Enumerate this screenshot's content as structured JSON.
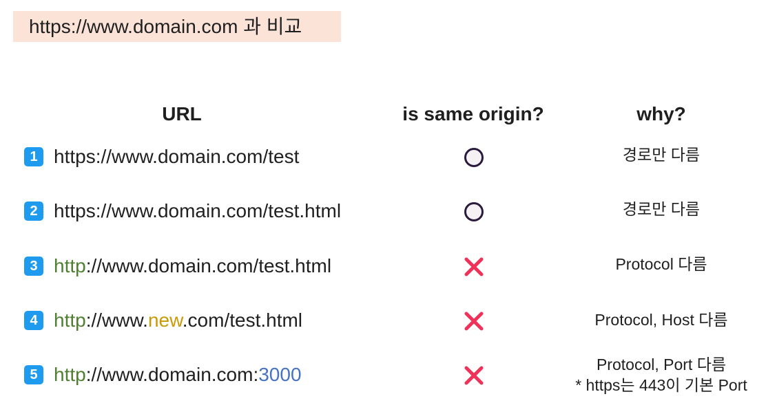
{
  "title": "https://www.domain.com 과 비교",
  "headers": {
    "url": "URL",
    "same": "is same origin?",
    "why": "why?"
  },
  "marks": {
    "ok": "circle-icon",
    "ng": "cross-icon"
  },
  "colors": {
    "protocol": "#4f7f30",
    "host": "#c99a05",
    "port": "#4672c4",
    "badge": "#1e9bef",
    "cross": "#f0325b",
    "circle": "#2a1a3b"
  },
  "rows": [
    {
      "num": "1",
      "url": {
        "a": "https://www.domain.com/test"
      },
      "same": "ok",
      "why": {
        "l1": "경로만 다름"
      }
    },
    {
      "num": "2",
      "url": {
        "a": "https://www.domain.com/test.html"
      },
      "same": "ok",
      "why": {
        "l1": "경로만 다름"
      }
    },
    {
      "num": "3",
      "url": {
        "p": "http",
        "a": "://www.domain.com/test.html"
      },
      "same": "ng",
      "why": {
        "l1": "Protocol 다름"
      }
    },
    {
      "num": "4",
      "url": {
        "p": "http",
        "a": "://www.",
        "h": "new",
        "b": ".com/test.html"
      },
      "same": "ng",
      "why": {
        "l1": "Protocol, Host 다름"
      }
    },
    {
      "num": "5",
      "url": {
        "p": "http",
        "a": "://www.domain.com:",
        "port": "3000"
      },
      "same": "ng",
      "why": {
        "l1": "Protocol, Port 다름",
        "l2": "* https는 443이 기본 Port"
      }
    }
  ]
}
